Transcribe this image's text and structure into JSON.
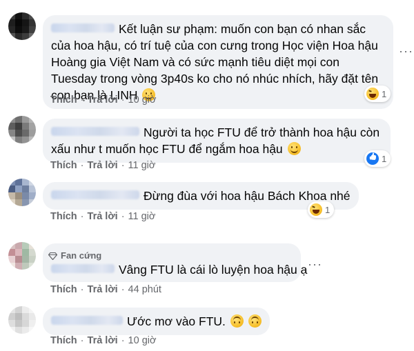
{
  "comments": [
    {
      "text": "Kết luận sư phạm: muốn con bạn có nhan sắc của hoa hậu, có trí tuệ của con cưng trong Học viện Hoa hậu Hoàng gia Việt Nam và có sức mạnh tiêu diệt mọi con Tuesday trong vòng 3p40s ko cho nó nhúc nhích, hãy đặt tên con bạn là LINH",
      "like_label": "Thích",
      "reply_label": "Trả lời",
      "time": "10 giờ",
      "reaction_icon": "haha-icon",
      "reaction_count": "1"
    },
    {
      "text": "Người ta học FTU để trở thành hoa hậu còn xấu như t muốn học FTU để ngắm hoa hậu",
      "like_label": "Thích",
      "reply_label": "Trả lời",
      "time": "11 giờ",
      "reaction_icon": "like-icon",
      "reaction_count": "1"
    },
    {
      "text": "Đừng đùa với hoa hậu Bách Khoa nhé",
      "like_label": "Thích",
      "reply_label": "Trả lời",
      "time": "11 giờ",
      "reaction_icon": "haha-icon",
      "reaction_count": "1"
    },
    {
      "badge": "Fan cứng",
      "text": "Vâng FTU là cái lò luyện hoa hậu ạ",
      "like_label": "Thích",
      "reply_label": "Trả lời",
      "time": "44 phút"
    },
    {
      "text": "Ước mơ vào FTU.",
      "like_label": "Thích",
      "reply_label": "Trả lời",
      "time": "10 giờ"
    }
  ],
  "more_options_label": "···",
  "colors": {
    "bubble": "#f0f2f5",
    "meta": "#65676b",
    "text": "#050505",
    "like_blue": "#1877f2"
  }
}
